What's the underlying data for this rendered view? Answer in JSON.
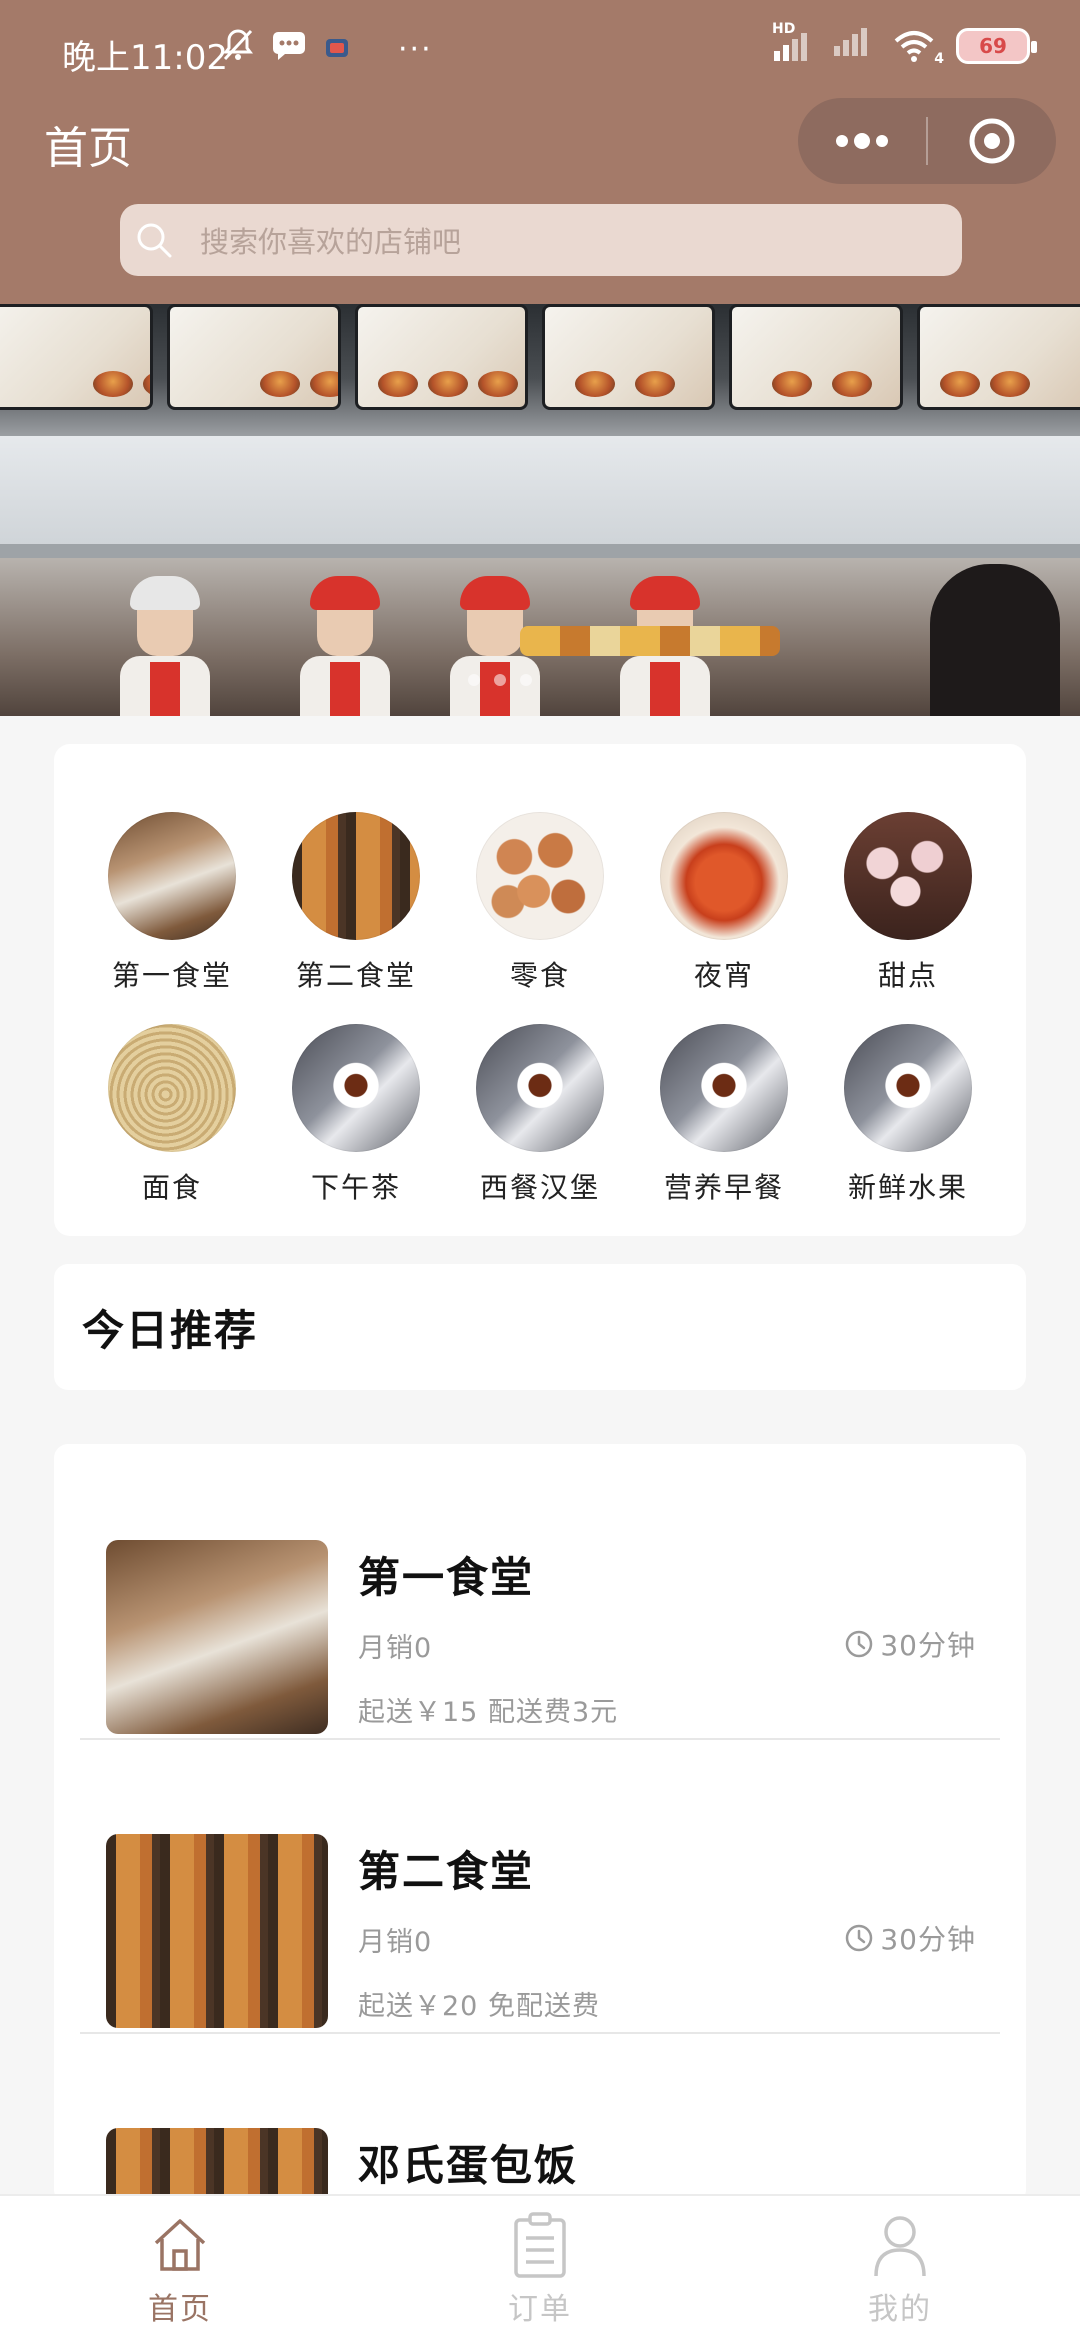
{
  "status_bar": {
    "time": "晚上11:02",
    "more": "···",
    "network": "HD",
    "wifi_badge": "4",
    "battery": "69"
  },
  "header": {
    "title": "首页",
    "background_color": "#a47a69"
  },
  "search": {
    "placeholder": "搜索你喜欢的店铺吧"
  },
  "categories": [
    {
      "label": "第一食堂",
      "icon": "canteen-photo"
    },
    {
      "label": "第二食堂",
      "icon": "canteen-food-photo"
    },
    {
      "label": "零食",
      "icon": "snack-photo"
    },
    {
      "label": "夜宵",
      "icon": "night-snack-photo"
    },
    {
      "label": "甜点",
      "icon": "dessert-photo"
    },
    {
      "label": "面食",
      "icon": "noodle-photo"
    },
    {
      "label": "下午茶",
      "icon": "tea-photo"
    },
    {
      "label": "西餐汉堡",
      "icon": "tea-photo"
    },
    {
      "label": "营养早餐",
      "icon": "tea-photo"
    },
    {
      "label": "新鲜水果",
      "icon": "tea-photo"
    }
  ],
  "recommend": {
    "title": "今日推荐"
  },
  "stores": [
    {
      "name": "第一食堂",
      "sales": "月销0",
      "time": "30分钟",
      "delivery": "起送￥15 配送费3元"
    },
    {
      "name": "第二食堂",
      "sales": "月销0",
      "time": "30分钟",
      "delivery": "起送￥20 免配送费"
    },
    {
      "name": "邓氏蛋包饭",
      "sales": "",
      "time": "",
      "delivery": ""
    }
  ],
  "tab_bar": {
    "tabs": [
      {
        "label": "首页",
        "icon": "home-icon",
        "active": true
      },
      {
        "label": "订单",
        "icon": "order-icon",
        "active": false
      },
      {
        "label": "我的",
        "icon": "user-icon",
        "active": false
      }
    ],
    "active_color": "#9a7464",
    "inactive_color": "#c6c6c6"
  }
}
